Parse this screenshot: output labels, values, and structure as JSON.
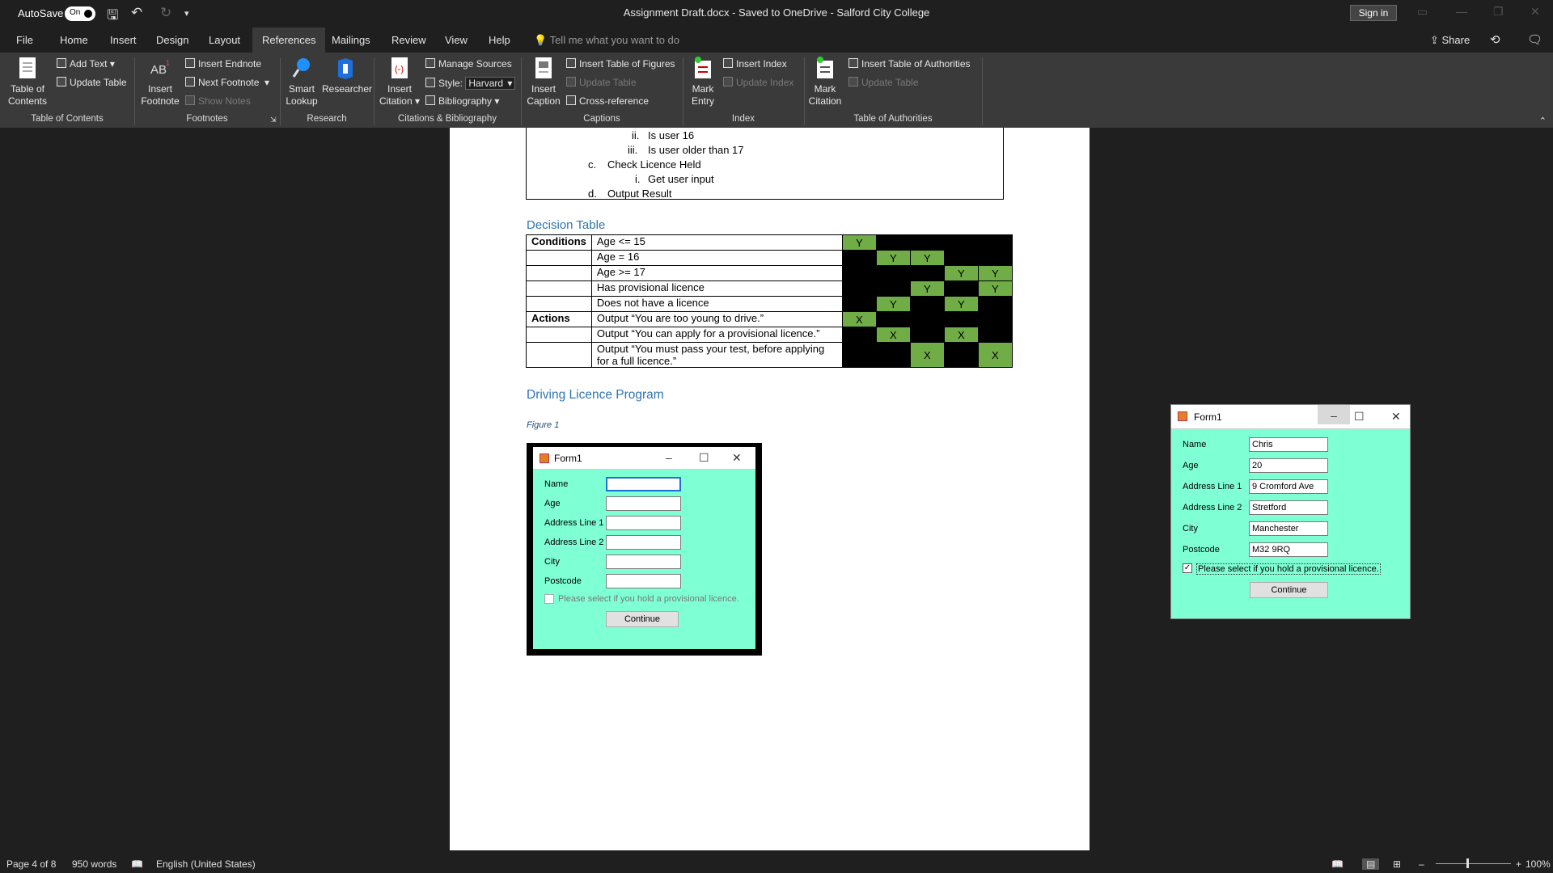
{
  "titlebar": {
    "autosave_label": "AutoSave",
    "autosave_state": "On",
    "doc_title": "Assignment Draft.docx  -  Saved to OneDrive - Salford City College",
    "signin": "Sign in"
  },
  "tabs": [
    "File",
    "Home",
    "Insert",
    "Design",
    "Layout",
    "References",
    "Mailings",
    "Review",
    "View",
    "Help"
  ],
  "active_tab": "References",
  "tellme": "Tell me what you want to do",
  "share": "Share",
  "ribbon": {
    "toc_btn": "Table of\nContents",
    "add_text": "Add Text",
    "update_table": "Update Table",
    "toc_group": "Table of Contents",
    "insert_footnote": "Insert\nFootnote",
    "insert_endnote": "Insert Endnote",
    "next_footnote": "Next Footnote",
    "show_notes": "Show Notes",
    "footnotes_group": "Footnotes",
    "smart_lookup": "Smart\nLookup",
    "researcher": "Researcher",
    "research_group": "Research",
    "insert_citation": "Insert\nCitation",
    "manage_sources": "Manage Sources",
    "style_label": "Style:",
    "style_value": "Harvard",
    "bibliography": "Bibliography",
    "citations_group": "Citations & Bibliography",
    "insert_caption": "Insert\nCaption",
    "insert_tof": "Insert Table of Figures",
    "update_table2": "Update Table",
    "cross_reference": "Cross-reference",
    "captions_group": "Captions",
    "mark_entry": "Mark\nEntry",
    "insert_index": "Insert Index",
    "update_index": "Update Index",
    "index_group": "Index",
    "mark_citation": "Mark\nCitation",
    "insert_toa": "Insert Table of Authorities",
    "update_table3": "Update Table",
    "toa_group": "Table of Authorities"
  },
  "doc": {
    "list": [
      {
        "num": "ii.",
        "text": "Is user 16"
      },
      {
        "num": "iii.",
        "text": "Is user older than 17"
      },
      {
        "num": "c.",
        "text": "Check Licence Held"
      },
      {
        "num": "i.",
        "text": "Get user input"
      },
      {
        "num": "d.",
        "text": "Output Result"
      }
    ],
    "decision_heading": "Decision Table",
    "rows": [
      {
        "c1": "Conditions",
        "c2": "Age <= 15",
        "m": [
          "Y",
          "",
          "",
          "",
          ""
        ],
        "g": [
          1,
          0,
          0,
          0,
          0
        ]
      },
      {
        "c1": "",
        "c2": "Age = 16",
        "m": [
          "",
          "Y",
          "Y",
          "",
          ""
        ],
        "g": [
          0,
          1,
          1,
          0,
          0
        ]
      },
      {
        "c1": "",
        "c2": "Age >= 17",
        "m": [
          "",
          "",
          "",
          "Y",
          "Y"
        ],
        "g": [
          0,
          0,
          0,
          1,
          1
        ]
      },
      {
        "c1": "",
        "c2": "Has provisional licence",
        "m": [
          "",
          "",
          "Y",
          "",
          "Y"
        ],
        "g": [
          0,
          0,
          1,
          0,
          1
        ]
      },
      {
        "c1": "",
        "c2": "Does not have a licence",
        "m": [
          "",
          "Y",
          "",
          "Y",
          ""
        ],
        "g": [
          0,
          1,
          0,
          1,
          0
        ]
      },
      {
        "c1": "Actions",
        "c2": "Output “You are too young to drive.”",
        "m": [
          "X",
          "",
          "",
          "",
          ""
        ],
        "g": [
          1,
          0,
          0,
          0,
          0
        ]
      },
      {
        "c1": "",
        "c2": "Output “You can apply for a provisional licence.”",
        "m": [
          "",
          "X",
          "",
          "X",
          ""
        ],
        "g": [
          0,
          1,
          0,
          1,
          0
        ]
      },
      {
        "c1": "",
        "c2": "Output “You must pass your test, before applying for a full licence.”",
        "m": [
          "",
          "",
          "X",
          "",
          "X"
        ],
        "g": [
          0,
          0,
          1,
          0,
          1
        ]
      }
    ],
    "program_heading": "Driving Licence Program",
    "figure_caption": "Figure 1"
  },
  "form_empty": {
    "title": "Form1",
    "labels": [
      "Name",
      "Age",
      "Address Line 1",
      "Address Line 2",
      "City",
      "Postcode"
    ],
    "values": [
      "",
      "",
      "",
      "",
      "",
      ""
    ],
    "checkbox_label": "Please select if you hold a provisional licence.",
    "checked": false,
    "button": "Continue"
  },
  "form_filled": {
    "title": "Form1",
    "labels": [
      "Name",
      "Age",
      "Address Line 1",
      "Address Line 2",
      "City",
      "Postcode"
    ],
    "values": [
      "Chris",
      "20",
      "9 Cromford Ave",
      "Stretford",
      "Manchester",
      "M32 9RQ"
    ],
    "checkbox_label": "Please select if you hold a provisional licence.",
    "checked": true,
    "check_mark": "✓",
    "button": "Continue"
  },
  "status": {
    "page": "Page 4 of 8",
    "words": "950 words",
    "language": "English (United States)",
    "zoom": "100%"
  }
}
